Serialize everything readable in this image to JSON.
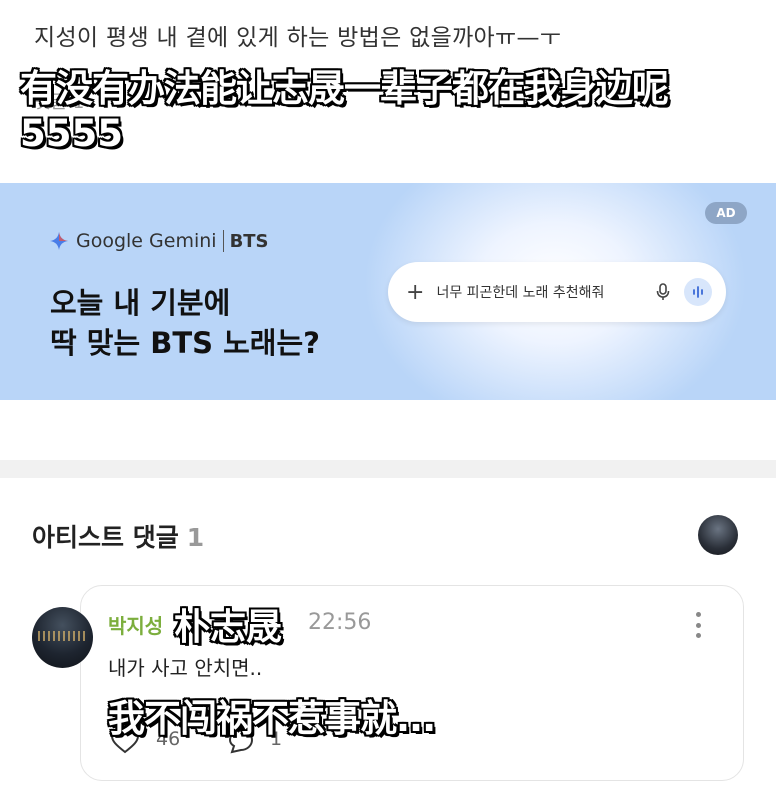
{
  "post": {
    "text": "지성이 평생 내 곁에 있게 하는 방법은 없을까아ㅠ—ㅜ",
    "faded_comments": "댓글 1"
  },
  "subtitles": {
    "top_line1": "有没有办法能让志晟一辈子都在我身边呢",
    "top_line2": "5555",
    "name": "朴志晟",
    "reply": "我不闯祸不惹事就..."
  },
  "ad": {
    "badge": "AD",
    "brand": "Google Gemini",
    "brand_partner": "BTS",
    "headline_line1": "오늘 내 기분에",
    "headline_line2": "딱 맞는 BTS 노래는?",
    "search_prompt": "너무 피곤한데 노래 추천해줘",
    "icons": [
      "gemini-spark-icon",
      "plus-icon",
      "mic-icon",
      "voice-wave-icon"
    ],
    "colors": {
      "background": "#aacbf5",
      "badge": "#8ea6c6"
    }
  },
  "artist_comments": {
    "title": "아티스트 댓글",
    "count": "1",
    "comment": {
      "author": "박지성",
      "time": "22:56",
      "body": "내가 사고 안치면..",
      "likes": "46",
      "replies": "1",
      "author_color": "#7cae3d"
    }
  }
}
